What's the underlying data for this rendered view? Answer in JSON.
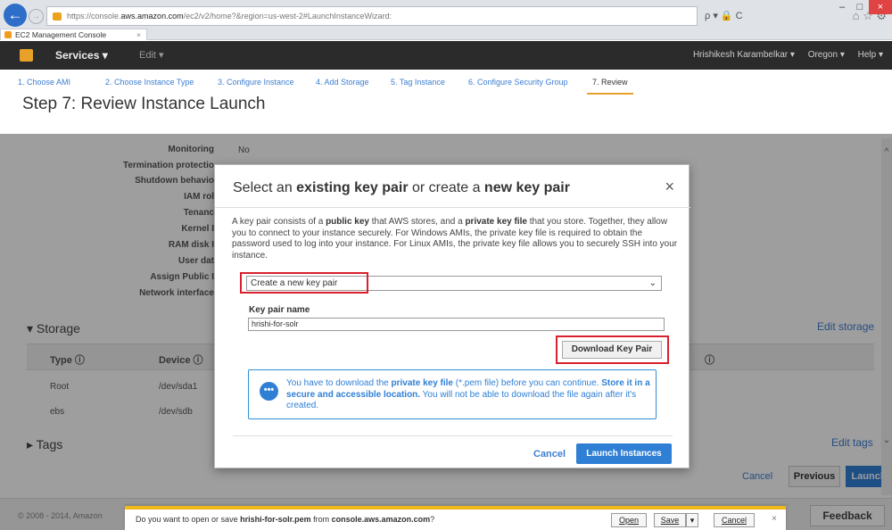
{
  "browser": {
    "url_prefix": "https://console.",
    "url_domain": "aws.amazon.com",
    "url_rest": "/ec2/v2/home?&region=us-west-2#LaunchInstanceWizard:",
    "tab_title": "EC2 Management Console",
    "tab_close": "×",
    "addr_tools": "ρ ▾ 🔒 C",
    "nav_icons": "⌂ ☆ ⚙",
    "win_min": "–",
    "win_max": "□",
    "win_close": "×"
  },
  "aws_nav": {
    "services": "Services ▾",
    "edit": "Edit ▾",
    "user": "Hrishikesh Karambelkar ▾",
    "region": "Oregon ▾",
    "help": "Help ▾"
  },
  "steps": [
    "1. Choose AMI",
    "2. Choose Instance Type",
    "3. Configure Instance",
    "4. Add Storage",
    "5. Tag Instance",
    "6. Configure Security Group",
    "7. Review"
  ],
  "page_title": "Step 7: Review Instance Launch",
  "details": {
    "rows": [
      "Monitoring",
      "Termination protectio",
      "Shutdown behavio",
      "IAM rol",
      "Tenanc",
      "Kernel I",
      "RAM disk I",
      "User dat",
      "Assign Public I",
      "Network interface"
    ],
    "monitoring_value": "No"
  },
  "storage": {
    "heading": "▾  Storage",
    "edit_link": "Edit storage",
    "col_type": "Type  ⓘ",
    "col_device": "Device  ⓘ",
    "col_info": "ⓘ",
    "rows": [
      {
        "type": "Root",
        "device": "/dev/sda1"
      },
      {
        "type": "ebs",
        "device": "/dev/sdb"
      }
    ]
  },
  "tags": {
    "heading": "▸  Tags",
    "edit_link": "Edit tags"
  },
  "footer_buttons": {
    "cancel": "Cancel",
    "previous": "Previous",
    "launch": "Launch"
  },
  "footer": {
    "copyright": "© 2008 - 2014, Amazon",
    "feedback": "Feedback"
  },
  "scrollbar": {
    "up": "^",
    "down": "⌄"
  },
  "modal": {
    "title_1": "Select an ",
    "title_2": "existing key pair",
    "title_3": " or create a ",
    "title_4": "new key pair",
    "close": "×",
    "desc_1": "A key pair consists of a ",
    "desc_2": "public key",
    "desc_3": " that AWS stores, and a ",
    "desc_4": "private key file",
    "desc_5": " that you store. Together, they allow you to connect to your instance securely. For Windows AMIs, the private key file is required to obtain the password used to log into your instance. For Linux AMIs, the private key file allows you to securely SSH into your instance.",
    "select_value": "Create a new key pair",
    "select_chevron": "⌄",
    "keyname_label": "Key pair name",
    "keyname_value": "hrishi-for-solr",
    "download_button": "Download Key Pair",
    "info_icon": "•••",
    "info_1": "You have to download the ",
    "info_2": "private key file",
    "info_3": " (*.pem file) before you can continue. ",
    "info_4": "Store it in a secure and accessible location.",
    "info_5": " You will not be able to download the file again after it's created.",
    "cancel": "Cancel",
    "launch": "Launch Instances"
  },
  "download_bar": {
    "text_1": "Do you want to open or save ",
    "filename": "hrishi-for-solr.pem",
    "text_2": " from ",
    "source": "console.aws.amazon.com",
    "text_3": "?",
    "open": "Open",
    "save": "Save",
    "save_arrow": "▾",
    "cancel": "Cancel",
    "close": "×"
  },
  "colors": {
    "aws_orange": "#e8a029",
    "link_blue": "#3c7ed1",
    "button_blue": "#2f7fd5",
    "highlight_red": "#d9202e",
    "notification_yellow": "#f2b71b"
  }
}
